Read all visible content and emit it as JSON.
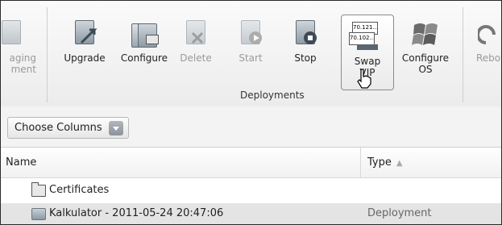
{
  "ribbon": {
    "buttons": [
      {
        "label": "aging\nment",
        "state": "partial",
        "icon": "staging-icon"
      },
      {
        "label": "Upgrade",
        "state": "enabled",
        "icon": "upgrade-icon"
      },
      {
        "label": "Configure",
        "state": "enabled",
        "icon": "configure-icon"
      },
      {
        "label": "Delete",
        "state": "disabled",
        "icon": "delete-icon"
      },
      {
        "label": "Start",
        "state": "disabled",
        "icon": "start-icon"
      },
      {
        "label": "Stop",
        "state": "enabled",
        "icon": "stop-icon"
      },
      {
        "label": "Swap\nVIP",
        "state": "hover",
        "icon": "swap-vip-icon"
      },
      {
        "label": "Configure\nOS",
        "state": "enabled",
        "icon": "configure-os-icon"
      },
      {
        "label": "Rebo",
        "state": "partial",
        "icon": "reboot-icon"
      }
    ],
    "group_label": "Deployments",
    "swap_icon_text_1": "70.121...",
    "swap_icon_text_2": "70.102..."
  },
  "toolbar": {
    "choose_columns_label": "Choose Columns"
  },
  "grid": {
    "columns": [
      "Name",
      "Type"
    ],
    "sort_indicator": "▲",
    "rows": [
      {
        "name": "Certificates",
        "type": "",
        "icon": "folder-icon"
      },
      {
        "name": "Kalkulator - 2011-05-24 20:47:06",
        "type": "Deployment",
        "icon": "deployment-icon"
      }
    ]
  }
}
